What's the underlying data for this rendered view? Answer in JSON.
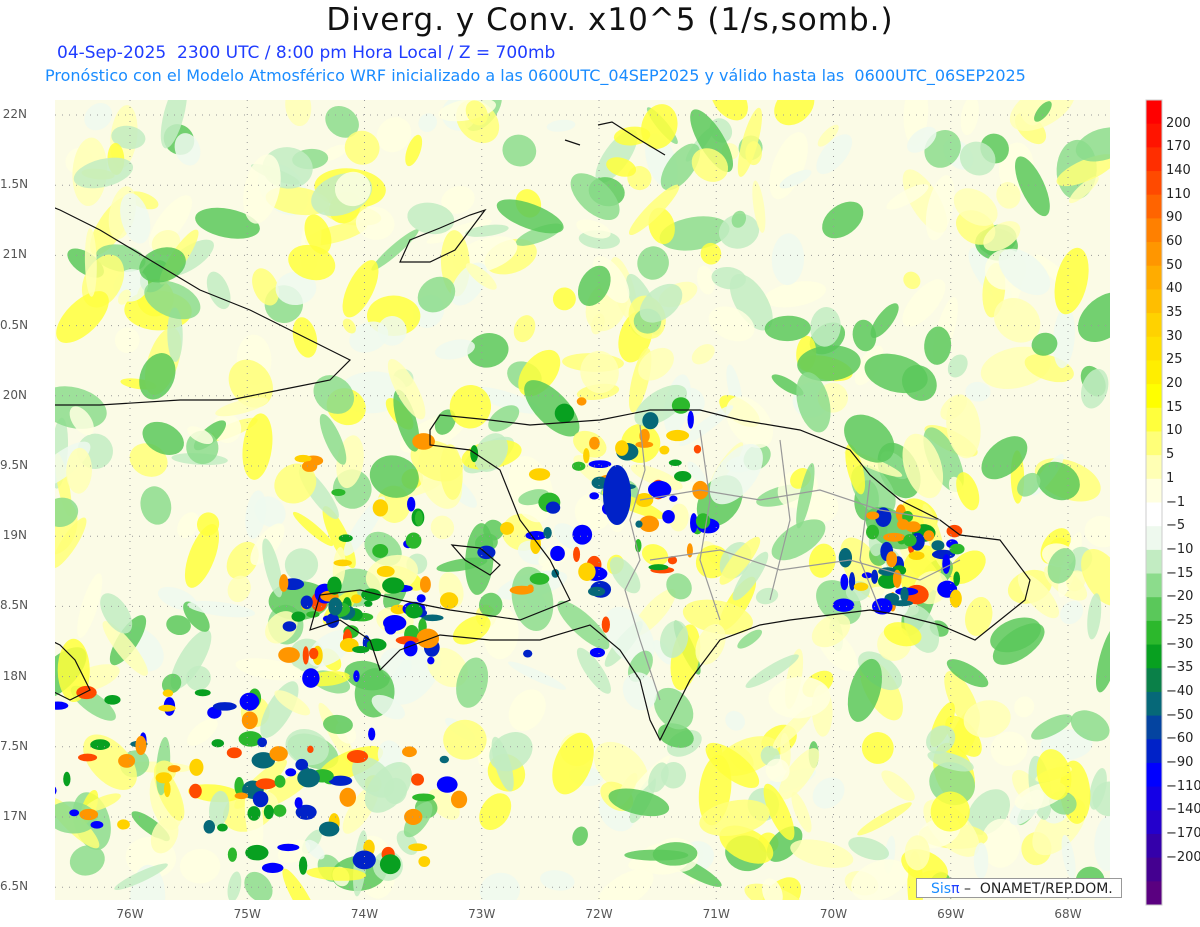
{
  "header": {
    "title": "Diverg. y Conv. x10^5 (1/s,somb.)",
    "valid_line": "04-Sep-2025  2300 UTC / 8:00 pm Hora Local / Z = 700mb",
    "forecast_line": "Pronóstico con el Modelo Atmosférico WRF inicializado a las 0600UTC_04SEP2025 y válido hasta las  0600UTC_06SEP2025"
  },
  "axes": {
    "lat_labels": [
      {
        "lat": 22,
        "label": "22N"
      },
      {
        "lat": 21.5,
        "label": "1.5N"
      },
      {
        "lat": 21,
        "label": "21N"
      },
      {
        "lat": 20.5,
        "label": "0.5N"
      },
      {
        "lat": 20,
        "label": "20N"
      },
      {
        "lat": 19.5,
        "label": "9.5N"
      },
      {
        "lat": 19,
        "label": "19N"
      },
      {
        "lat": 18.5,
        "label": "8.5N"
      },
      {
        "lat": 18,
        "label": "18N"
      },
      {
        "lat": 17.5,
        "label": "7.5N"
      },
      {
        "lat": 17,
        "label": "17N"
      },
      {
        "lat": 16.5,
        "label": "6.5N"
      }
    ],
    "lon_labels": [
      {
        "lon": -76,
        "label": "76W"
      },
      {
        "lon": -75,
        "label": "75W"
      },
      {
        "lon": -74,
        "label": "74W"
      },
      {
        "lon": -73,
        "label": "73W"
      },
      {
        "lon": -72,
        "label": "72W"
      },
      {
        "lon": -71,
        "label": "71W"
      },
      {
        "lon": -70,
        "label": "70W"
      },
      {
        "lon": -69,
        "label": "69W"
      },
      {
        "lon": -68,
        "label": "68W"
      }
    ]
  },
  "colorbar": {
    "labels": [
      "200",
      "170",
      "140",
      "110",
      "90",
      "60",
      "50",
      "40",
      "35",
      "30",
      "25",
      "20",
      "15",
      "10",
      "5",
      "1",
      "−1",
      "−5",
      "−10",
      "−15",
      "−20",
      "−25",
      "−30",
      "−35",
      "−40",
      "−50",
      "−60",
      "−90",
      "−110",
      "−140",
      "−170",
      "−200"
    ],
    "colors": [
      "#ff0000",
      "#ff1400",
      "#ff2e00",
      "#ff4a00",
      "#ff6400",
      "#ff8000",
      "#ff9600",
      "#ffac00",
      "#ffbe00",
      "#ffd200",
      "#ffe000",
      "#ffee00",
      "#ffff00",
      "#ffff3c",
      "#ffff78",
      "#ffffb4",
      "#ffffe0",
      "#ffffff",
      "#eef9ee",
      "#c2ecc2",
      "#8cdc8c",
      "#5ac85a",
      "#2cb82c",
      "#08a020",
      "#0a8048",
      "#066878",
      "#0444a0",
      "#0022c8",
      "#0000ff",
      "#1400e6",
      "#2400cc",
      "#3400aa",
      "#440090",
      "#5a0080"
    ]
  },
  "credit": {
    "brand_sis": "Sis",
    "brand_pi": "π",
    "text": " –  ONAMET/REP.DOM."
  }
}
